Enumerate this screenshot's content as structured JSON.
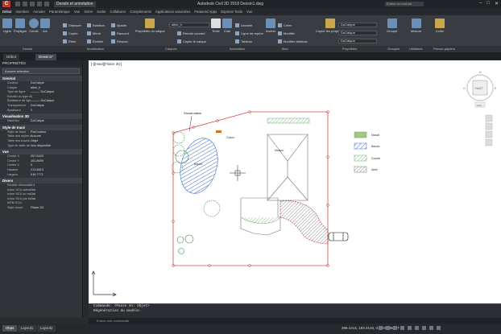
{
  "app": {
    "title": "Autodesk Civil 3D 2018  Dessin1.dwg",
    "workspace": "Dessin et annotation",
    "search_placeholder": "Entrez un mot-clé",
    "window_buttons": [
      "–",
      "□",
      "✕"
    ]
  },
  "ribbon_tabs": [
    "Début",
    "Insertion",
    "Annoter",
    "Paramétrique",
    "Vue",
    "Gérer",
    "Sortie",
    "Collaborer",
    "Complements",
    "Applications associées",
    "Featured Apps",
    "Express Tools",
    "Vue"
  ],
  "ribbon": {
    "draw": [
      "Ligne",
      "Polyligne",
      "Cercle",
      "Arc"
    ],
    "modify": [
      "Déplacer",
      "Rotation",
      "Ajuster",
      "Copier",
      "Miroir",
      "Raccord",
      "Étirer",
      "Échelle",
      "Réseau"
    ],
    "layers_tool": "Propriétés du calque",
    "layer_combo": "allee_h",
    "layer_tools": [
      "Rendre courant",
      "Copier le calque"
    ],
    "annotation": [
      "Texte",
      "Cote",
      "Linéaire",
      "Ligne de repère",
      "Tableau"
    ],
    "block": [
      "Insérer",
      "Créer",
      "Modifier",
      "Modifier attributs"
    ],
    "properties_tool": "Copier les propriétés",
    "prop_combos": [
      "DuCalque",
      "DuCalque",
      "DuCalque"
    ],
    "groups_tool": "Groupe",
    "utilities_tool": "Mesure",
    "clipboard_tool": "Coller",
    "panel_labels": [
      "Dessin",
      "Modification",
      "Calques",
      "Annotation",
      "Bloc",
      "Propriétés",
      "Groupes",
      "Utilitaires",
      "Presse-papiers"
    ]
  },
  "doc_tabs": [
    "Début",
    "Dessin1*"
  ],
  "properties_palette": {
    "title": "PROPRIÉTÉS",
    "selection": "Aucune sélection",
    "sections": [
      {
        "name": "Général",
        "rows": [
          [
            "Couleur",
            "DuCalque"
          ],
          [
            "Calque",
            "allee_h"
          ],
          [
            "Type de ligne",
            "——— DuCalque"
          ],
          [
            "Échelle du type de...",
            "1"
          ],
          [
            "Épaisseur de ligne",
            "——— DuCalque"
          ],
          [
            "Transparence",
            "DuCalque"
          ],
          [
            "Épaisseur",
            "0"
          ]
        ]
      },
      {
        "name": "Visualisation 3D",
        "rows": [
          [
            "Matériau",
            "DuCalque"
          ]
        ]
      },
      {
        "name": "Style de tracé",
        "rows": [
          [
            "Style de tracé",
            "ParCouleur"
          ],
          [
            "Table des styles de...",
            "Aucune"
          ],
          [
            "Table des tracés att...",
            "Objet"
          ],
          [
            "Type de table de tr...",
            "Non disponible"
          ]
        ]
      },
      {
        "name": "Vue",
        "rows": [
          [
            "Centre X",
            "257.5420"
          ],
          [
            "Centre Y",
            "151.8699"
          ],
          [
            "Centre Z",
            "0"
          ],
          [
            "Hauteur",
            "213.8813"
          ],
          [
            "Largeur",
            "516.7771"
          ]
        ]
      },
      {
        "name": "Divers",
        "rows": [
          [
            "Échelle d'annotation",
            "1:1"
          ],
          [
            "Icône SCU active",
            "Oui"
          ],
          [
            "Icône SCU au niveau...",
            "Oui"
          ],
          [
            "Icône SCU par fenê...",
            "Oui"
          ],
          [
            "NOM SCU",
            ""
          ],
          [
            "Style visuel",
            "Filaire 2D"
          ]
        ]
      }
    ]
  },
  "viewport": {
    "label": "[-][Haut][Filaire 2D]",
    "viewcube": {
      "face": "HAUT",
      "n": "N",
      "s": "S",
      "e": "E",
      "o": "O",
      "scu": "SCU"
    }
  },
  "drawing": {
    "labels": {
      "tree_note": "Groove mileur",
      "garden": "Gazon",
      "house": "Maison",
      "pool": "Bassin"
    },
    "legend": [
      {
        "label": "Massif",
        "color": "#7a9d5c"
      },
      {
        "label": "Bassin",
        "color": "#3a72c8"
      },
      {
        "label": "Gravier",
        "color": "#6fae6f"
      },
      {
        "label": "Allée",
        "color": "#888888"
      }
    ]
  },
  "command": {
    "lines": [
      "Commande:  <Passe en: Objet>",
      "Régénération du modèle."
    ],
    "input_placeholder": "Entrez une commande"
  },
  "status": {
    "layout_tabs": [
      "Objet",
      "Layout1",
      "Layout2"
    ],
    "coords": "266.1214, 183.2133, 0.0000   OBJET"
  }
}
